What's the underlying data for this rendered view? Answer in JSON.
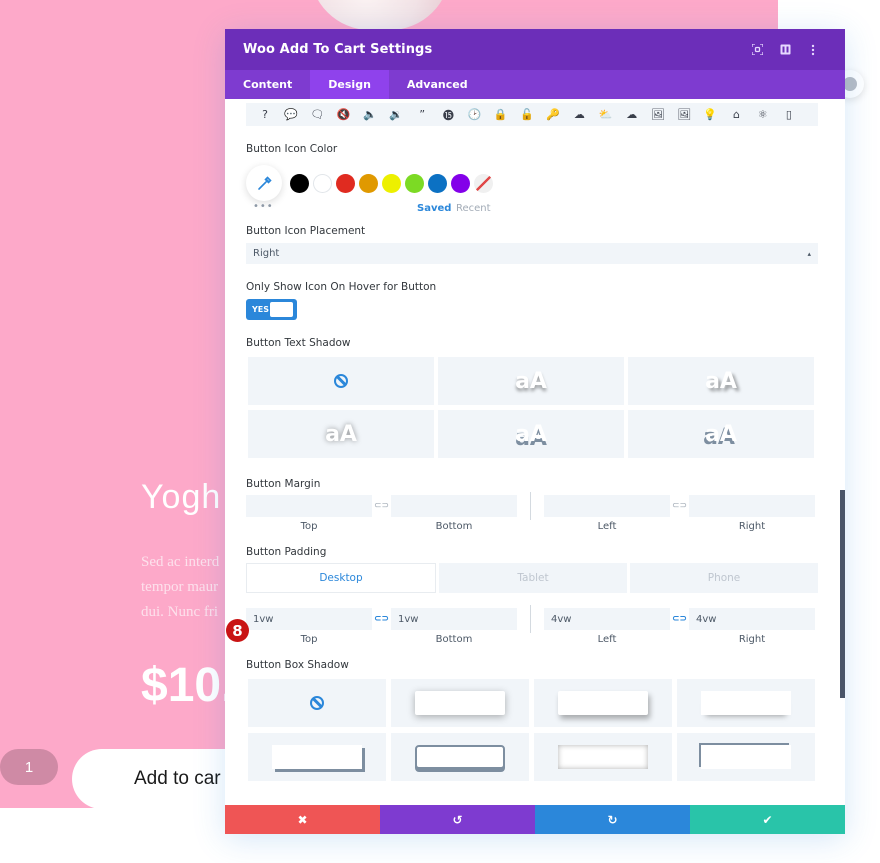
{
  "product": {
    "title": "Yogh",
    "description_lines": [
      "Sed ac interd",
      "tempor maur",
      "dui. Nunc fri"
    ],
    "price": "$10.",
    "quantity": "1",
    "add_to_cart_label": "Add to car"
  },
  "modal": {
    "title": "Woo Add To Cart Settings",
    "header_icons": [
      "fullscreen-icon",
      "split-view-icon",
      "more-options-icon"
    ],
    "tabs": [
      {
        "label": "Content",
        "active": false
      },
      {
        "label": "Design",
        "active": true
      },
      {
        "label": "Advanced",
        "active": false
      }
    ],
    "icon_strip": [
      "?",
      "💬",
      "🗨",
      "🔇",
      "🔈",
      "🔉",
      "”",
      "⓯",
      "🕑",
      "🔒",
      "🔓",
      "🔑",
      "☁",
      "⛅",
      "☁",
      "🖼",
      "🖼",
      "💡",
      "⌂",
      "⚛",
      "▯"
    ],
    "icon_strip_names": [
      "question-icon",
      "chat-bubble-icon",
      "chat-bubbles-icon",
      "mute-icon",
      "volume-low-icon",
      "volume-high-icon",
      "quote-icon",
      "quote-circle-icon",
      "clock-icon",
      "lock-icon",
      "unlock-icon",
      "key-icon",
      "cloud-icon",
      "cloud-upload-icon",
      "cloud-download-icon",
      "image-icon",
      "images-icon",
      "lightbulb-icon",
      "home-icon",
      "gear-icon",
      "mobile-icon"
    ],
    "button_icon_color": {
      "label": "Button Icon Color",
      "swatches": [
        "#000000",
        "#ffffff",
        "#e02b20",
        "#e09900",
        "#edf000",
        "#7cda24",
        "#0c71c3",
        "#8300e9",
        "none"
      ],
      "saved_label": "Saved",
      "recent_label": "Recent",
      "more_label": "•••"
    },
    "button_icon_placement": {
      "label": "Button Icon Placement",
      "value": "Right"
    },
    "only_show_icon_on_hover": {
      "label": "Only Show Icon On Hover for Button",
      "toggle_label": "YES",
      "value": true
    },
    "button_text_shadow": {
      "label": "Button Text Shadow",
      "preview_text": "aA",
      "options": [
        "none",
        "shadow-1",
        "shadow-2",
        "shadow-3",
        "shadow-4",
        "shadow-5"
      ]
    },
    "button_margin": {
      "label": "Button Margin",
      "top": "",
      "bottom": "",
      "left": "",
      "right": "",
      "side_labels": [
        "Top",
        "Bottom",
        "Left",
        "Right"
      ]
    },
    "button_padding": {
      "label": "Button Padding",
      "device_tabs": [
        {
          "label": "Desktop",
          "active": true
        },
        {
          "label": "Tablet",
          "active": false
        },
        {
          "label": "Phone",
          "active": false
        }
      ],
      "top": "1vw",
      "bottom": "1vw",
      "left": "4vw",
      "right": "4vw",
      "side_labels": [
        "Top",
        "Bottom",
        "Left",
        "Right"
      ]
    },
    "button_box_shadow": {
      "label": "Button Box Shadow",
      "options": [
        "none",
        "shadow-1",
        "shadow-2",
        "shadow-3",
        "shadow-4",
        "shadow-5",
        "shadow-6",
        "shadow-7"
      ]
    },
    "step_badge": "8",
    "footer": {
      "cancel": "✖",
      "undo": "↺",
      "redo": "↻",
      "save": "✔",
      "colors": {
        "cancel": "#ef5555",
        "undo": "#7e3bd0",
        "redo": "#2b87da",
        "save": "#29c4a9"
      }
    }
  },
  "colors": {
    "header": "#6c2eb9",
    "tabs": "#7e3bd0",
    "accent": "#2b87da",
    "page_bg": "#fda9c9"
  }
}
